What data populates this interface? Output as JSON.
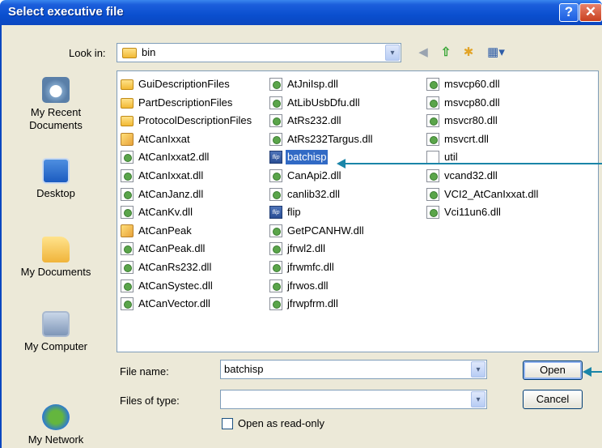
{
  "dialog": {
    "title": "Select executive file",
    "help_glyph": "?",
    "close_glyph": "✕"
  },
  "look_in": {
    "label": "Look in:",
    "value": "bin",
    "dropdown_glyph": "▾"
  },
  "toolbar": {
    "back_icon": "back-arrow-icon",
    "up_icon": "up-folder-icon",
    "new_folder_icon": "new-folder-icon",
    "views_icon": "views-menu-icon",
    "back_glyph": "◀",
    "up_glyph": "⇧",
    "new_folder_glyph": "✱",
    "views_glyph": "▦▾"
  },
  "places": [
    {
      "id": "recent",
      "label": "My Recent Documents"
    },
    {
      "id": "desktop",
      "label": "Desktop"
    },
    {
      "id": "docs",
      "label": "My Documents"
    },
    {
      "id": "computer",
      "label": "My Computer"
    },
    {
      "id": "network",
      "label": "My Network"
    }
  ],
  "files": {
    "col1": [
      {
        "name": "GuiDescriptionFiles",
        "type": "folder"
      },
      {
        "name": "PartDescriptionFiles",
        "type": "folder"
      },
      {
        "name": "ProtocolDescriptionFiles",
        "type": "folder"
      },
      {
        "name": "AtCanIxxat",
        "type": "exe"
      },
      {
        "name": "AtCanIxxat2.dll",
        "type": "dll"
      },
      {
        "name": "AtCanIxxat.dll",
        "type": "dll"
      },
      {
        "name": "AtCanJanz.dll",
        "type": "dll"
      },
      {
        "name": "AtCanKv.dll",
        "type": "dll"
      },
      {
        "name": "AtCanPeak",
        "type": "exe"
      },
      {
        "name": "AtCanPeak.dll",
        "type": "dll"
      },
      {
        "name": "AtCanRs232.dll",
        "type": "dll"
      },
      {
        "name": "AtCanSystec.dll",
        "type": "dll"
      },
      {
        "name": "AtCanVector.dll",
        "type": "dll"
      }
    ],
    "col2": [
      {
        "name": "AtJniIsp.dll",
        "type": "dll"
      },
      {
        "name": "AtLibUsbDfu.dll",
        "type": "dll"
      },
      {
        "name": "AtRs232.dll",
        "type": "dll"
      },
      {
        "name": "AtRs232Targus.dll",
        "type": "dll"
      },
      {
        "name": "batchisp",
        "type": "flip",
        "selected": true
      },
      {
        "name": "CanApi2.dll",
        "type": "dll"
      },
      {
        "name": "canlib32.dll",
        "type": "dll"
      },
      {
        "name": "flip",
        "type": "flip"
      },
      {
        "name": "GetPCANHW.dll",
        "type": "dll"
      },
      {
        "name": "jfrwl2.dll",
        "type": "dll"
      },
      {
        "name": "jfrwmfc.dll",
        "type": "dll"
      },
      {
        "name": "jfrwos.dll",
        "type": "dll"
      },
      {
        "name": "jfrwpfrm.dll",
        "type": "dll"
      }
    ],
    "col3": [
      {
        "name": "msvcp60.dll",
        "type": "dll"
      },
      {
        "name": "msvcp80.dll",
        "type": "dll"
      },
      {
        "name": "msvcr80.dll",
        "type": "dll"
      },
      {
        "name": "msvcrt.dll",
        "type": "dll"
      },
      {
        "name": "util",
        "type": "plain"
      },
      {
        "name": "vcand32.dll",
        "type": "dll"
      },
      {
        "name": "VCI2_AtCanIxxat.dll",
        "type": "dll"
      },
      {
        "name": "Vci11un6.dll",
        "type": "dll"
      }
    ],
    "flip_icon_text": "flip"
  },
  "file_name": {
    "label": "File name:",
    "value": "batchisp",
    "dropdown_glyph": "▾"
  },
  "file_type": {
    "label": "Files of type:",
    "value": "",
    "dropdown_glyph": "▾"
  },
  "buttons": {
    "open": "Open",
    "cancel": "Cancel"
  },
  "read_only": {
    "label": "Open as read-only",
    "checked": false
  },
  "colors": {
    "titlebar": "#0b47c0",
    "selection": "#316ac5",
    "annotation_arrow": "#1a85a8",
    "dialog_bg": "#ece9d8"
  }
}
